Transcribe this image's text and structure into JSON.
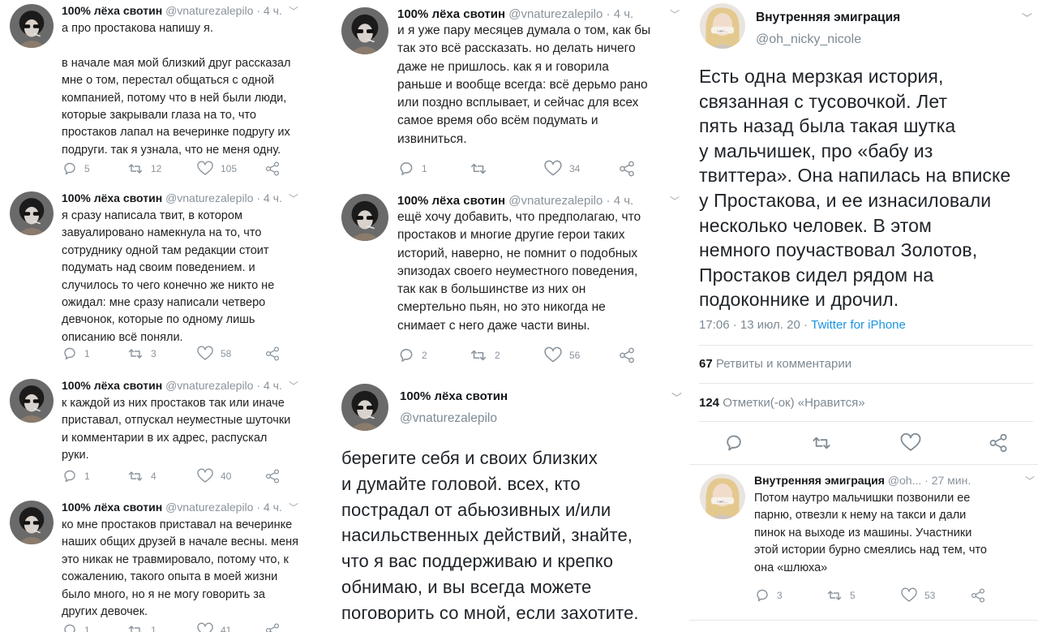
{
  "col1": {
    "tweets": [
      {
        "name": "100% лёха свотин",
        "handle": "@vnaturezalepilo",
        "dot": "·",
        "time": "4 ч.",
        "text": "а про простакова напишу я.\n\nв начале мая мой близкий друг рассказал\nмне о том, перестал общаться с одной\nкомпанией, потому что в ней были люди,\nкоторые закрывали глаза на то, что\nпростаков лапал на вечеринке подругу их\nподруги. так я узнала, что не меня одну.",
        "replies": "5",
        "retweets": "12",
        "likes": "105"
      },
      {
        "name": "100% лёха свотин",
        "handle": "@vnaturezalepilo",
        "dot": "·",
        "time": "4 ч.",
        "text": "я сразу написала твит, в котором\nзавуалировано намекнула на то, что\nсотруднику одной там редакции стоит\nподумать над своим поведением. и\nслучилось то чего конечно же никто не\nожидал: мне сразу написали четверо\nдевчонок, которые по одному лишь\nописанию всё поняли.",
        "replies": "1",
        "retweets": "3",
        "likes": "58"
      },
      {
        "name": "100% лёха свотин",
        "handle": "@vnaturezalepilo",
        "dot": "·",
        "time": "4 ч.",
        "text": "к каждой из них простаков так или иначе\nприставал, отпускал неуместные шуточки\nи комментарии в их адрес, распускал\nруки.",
        "replies": "1",
        "retweets": "4",
        "likes": "40"
      },
      {
        "name": "100% лёха свотин",
        "handle": "@vnaturezalepilo",
        "dot": "·",
        "time": "4 ч.",
        "text": "ко мне простаков приставал на вечеринке\nнаших общих друзей в начале весны. меня\nэто никак не травмировало, потому что, к\nсожалению, такого опыта в моей жизни\nбыло много, но я не могу говорить за\nдругих девочек.",
        "replies": "1",
        "retweets": "1",
        "likes": "41"
      }
    ]
  },
  "col2": {
    "tweets": [
      {
        "name": "100% лёха свотин",
        "handle": "@vnaturezalepilo",
        "dot": "·",
        "time": "4 ч.",
        "text": "и я уже пару месяцев думала о том, как бы\nтак это всё рассказать. но делать ничего\nдаже не пришлось. как я и говорила\nраньше и вообще всегда: всё дерьмо рано\nили поздно всплывает, и сейчас для всех\nсамое время обо всём подумать и\nизвиниться.",
        "replies": "1",
        "retweets": "",
        "likes": "34"
      },
      {
        "name": "100% лёха свотин",
        "handle": "@vnaturezalepilo",
        "dot": "·",
        "time": "4 ч.",
        "text": "ещё хочу добавить, что предполагаю, что\nпростаков и многие другие герои таких\nисторий, наверно, не помнит о подобных\nэпизодах своего неуместного поведения,\nтак как в большинстве из них он\nсмертельно пьян, но это никогда не\nснимает с него даже части вины.",
        "replies": "2",
        "retweets": "2",
        "likes": "56"
      }
    ],
    "big": {
      "name": "100% лёха свотин",
      "handle": "@vnaturezalepilo",
      "text": "берегите себя и своих близких\nи думайте головой. всех, кто\nпострадал от абьюзивных и/или\nнасильственных действий, знайте,\nчто я вас поддерживаю и крепко\nобнимаю, и вы всегда можете\nпоговорить со мной, если захотите."
    }
  },
  "col3": {
    "big": {
      "name": "Внутренняя эмиграция",
      "handle": "@oh_nicky_nicole",
      "text": "Есть одна мерзкая история,\nсвязанная с тусовочкой. Лет\nпять назад была такая шутка\nу мальчишек, про «бабу из\nтвиттера». Она напилась на вписке\nу Простакова, и ее изнасиловали\nнесколько человек. В этом\nнемного поучаствовал Золотов,\nПростаков сидел рядом на\nподоконнике и дрочил.",
      "time": "17:06 · 13 июл. 20 ·",
      "source": "Twitter for iPhone",
      "retweets_count": "67",
      "retweets_label": "Ретвиты и комментарии",
      "likes_count": "124",
      "likes_label": "Отметки(-ок) «Нравится»"
    },
    "reply": {
      "name": "Внутренняя эмиграция",
      "handle": "@oh...",
      "dot": "·",
      "time": "27 мин.",
      "text": "Потом наутро мальчишки позвонили ее\nпарню, отвезли к нему на такси и дали\nпинок на выходе из машины. Участники\nэтой истории бурно смеялись над тем, что\nона «шлюха»",
      "replies": "3",
      "retweets": "5",
      "likes": "53"
    }
  }
}
